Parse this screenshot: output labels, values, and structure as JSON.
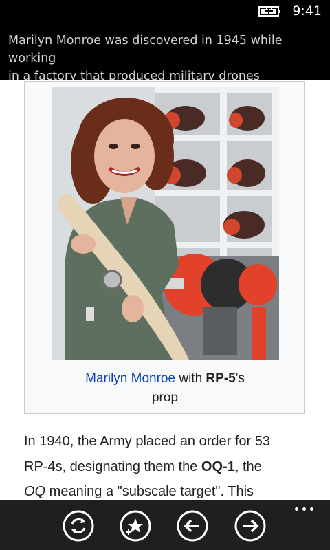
{
  "status_bar": {
    "time": "9:41",
    "battery_icon": "battery-charging-icon"
  },
  "browser": {
    "page_title_line1": "Marilyn Monroe was discovered in 1945 while working",
    "page_title_line2": "in a factory that produced military drones"
  },
  "article": {
    "image": {
      "description_icon": "photo-woman-holding-propeller"
    },
    "caption": {
      "link": "Marilyn Monroe",
      "text1": " with ",
      "bold": "RP-5",
      "text2": "'s",
      "line2": "prop"
    },
    "paragraph": {
      "line1": "In 1940, the Army placed an order for 53",
      "line2_text": "RP-4s, designating them the ",
      "line2_bold": "OQ-1",
      "line2_end": ", the",
      "line3_ital": "OQ",
      "line3_text": " meaning a \"subscale target\". This"
    }
  },
  "app_bar": {
    "buttons": [
      {
        "name": "refresh",
        "icon": "refresh-icon"
      },
      {
        "name": "favorites",
        "icon": "star-add-icon"
      },
      {
        "name": "back",
        "icon": "arrow-left-icon"
      },
      {
        "name": "forward",
        "icon": "arrow-right-icon"
      }
    ],
    "more_icon": "ellipsis-icon"
  },
  "colors": {
    "link": "#0b3fbf",
    "app_bar_bg": "#1f1f1f",
    "title_text": "#d4d4d4"
  }
}
